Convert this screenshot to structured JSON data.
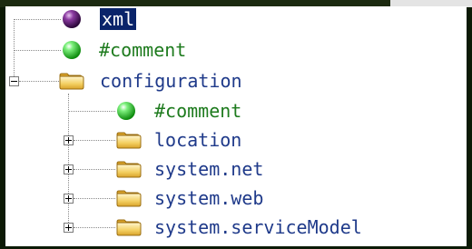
{
  "tree": {
    "nodes": [
      {
        "label": "xml",
        "type": "declaration",
        "selected": true
      },
      {
        "label": "#comment",
        "type": "comment"
      },
      {
        "label": "configuration",
        "type": "element",
        "expanded": true
      },
      {
        "label": "#comment",
        "type": "comment"
      },
      {
        "label": "location",
        "type": "element",
        "expanded": false
      },
      {
        "label": "system.net",
        "type": "element",
        "expanded": false
      },
      {
        "label": "system.web",
        "type": "element",
        "expanded": false
      },
      {
        "label": "system.serviceModel",
        "type": "element",
        "expanded": false
      }
    ]
  },
  "colors": {
    "selection": "#0a246a",
    "element_text": "#1f3a8a",
    "comment_text": "#1e7b1e",
    "declaration_icon": "#5a1a6e",
    "comment_icon": "#27c227",
    "folder_icon": "#e8b83a"
  },
  "icons": {
    "declaration": "purple-sphere-icon",
    "comment": "green-sphere-icon",
    "element": "folder-icon"
  }
}
